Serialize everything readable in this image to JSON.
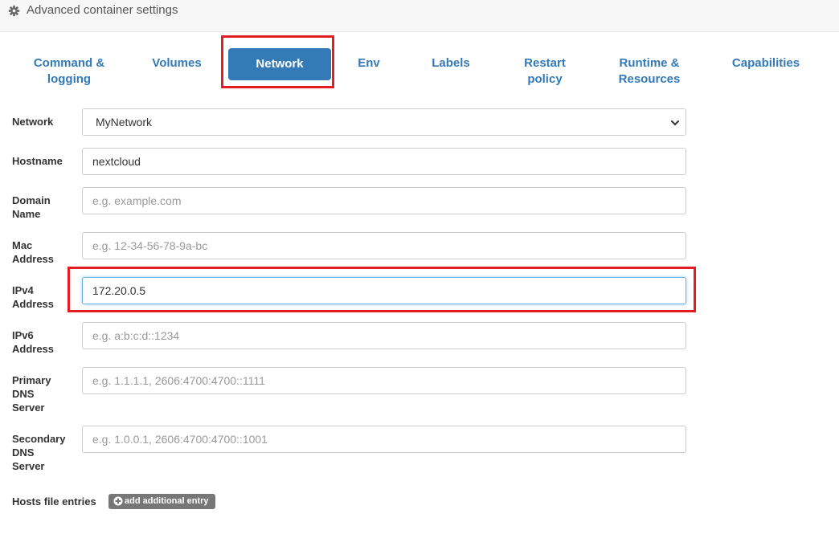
{
  "header": {
    "title": "Advanced container settings",
    "icon": "gear-icon"
  },
  "tabs": [
    {
      "label_line1": "Command &",
      "label_line2": "logging"
    },
    {
      "label_line1": "Volumes",
      "label_line2": ""
    },
    {
      "label_line1": "Network",
      "label_line2": "",
      "active": true
    },
    {
      "label_line1": "Env",
      "label_line2": ""
    },
    {
      "label_line1": "Labels",
      "label_line2": ""
    },
    {
      "label_line1": "Restart",
      "label_line2": "policy"
    },
    {
      "label_line1": "Runtime &",
      "label_line2": "Resources"
    },
    {
      "label_line1": "Capabilities",
      "label_line2": ""
    }
  ],
  "form": {
    "network": {
      "label": "Network",
      "value": "MyNetwork"
    },
    "hostname": {
      "label": "Hostname",
      "value": "nextcloud",
      "placeholder": ""
    },
    "domain": {
      "label_line1": "Domain",
      "label_line2": "Name",
      "value": "",
      "placeholder": "e.g. example.com"
    },
    "mac": {
      "label_line1": "Mac",
      "label_line2": "Address",
      "value": "",
      "placeholder": "e.g. 12-34-56-78-9a-bc"
    },
    "ipv4": {
      "label_line1": "IPv4",
      "label_line2": "Address",
      "value": "172.20.0.5",
      "placeholder": ""
    },
    "ipv6": {
      "label_line1": "IPv6",
      "label_line2": "Address",
      "value": "",
      "placeholder": "e.g. a:b:c:d::1234"
    },
    "primary_dns": {
      "label_line1": "Primary",
      "label_line2": "DNS",
      "label_line3": "Server",
      "value": "",
      "placeholder": "e.g. 1.1.1.1, 2606:4700:4700::1111"
    },
    "secondary_dns": {
      "label_line1": "Secondary",
      "label_line2": "DNS",
      "label_line3": "Server",
      "value": "",
      "placeholder": "e.g. 1.0.0.1, 2606:4700:4700::1001"
    },
    "hosts": {
      "label": "Hosts file entries",
      "button_label": "add additional entry"
    }
  },
  "colors": {
    "accent": "#337ab7",
    "highlight": "#e31c23",
    "button_gray": "#777777"
  }
}
